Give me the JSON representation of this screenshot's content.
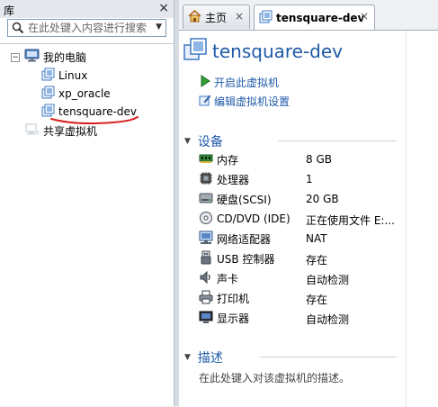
{
  "library": {
    "title": "库",
    "close": "×",
    "search_placeholder": "在此处键入内容进行搜索",
    "tree": {
      "root_label": "我的电脑",
      "vms": [
        {
          "label": "Linux"
        },
        {
          "label": "xp_oracle"
        },
        {
          "label": "tensquare-dev"
        }
      ],
      "shared_label": "共享虚拟机"
    }
  },
  "tabs": [
    {
      "label": "主页",
      "icon": "home-icon"
    },
    {
      "label": "tensquare-dev",
      "icon": "vm-icon",
      "active": true
    }
  ],
  "vm": {
    "title": "tensquare-dev",
    "actions": [
      {
        "label": "开启此虚拟机",
        "icon": "play-icon"
      },
      {
        "label": "编辑虚拟机设置",
        "icon": "edit-settings-icon"
      }
    ],
    "devices_title": "设备",
    "devices": [
      {
        "name": "内存",
        "value": "8 GB",
        "icon": "memory-icon"
      },
      {
        "name": "处理器",
        "value": "1",
        "icon": "cpu-icon"
      },
      {
        "name": "硬盘(SCSI)",
        "value": "20 GB",
        "icon": "hard-disk-icon"
      },
      {
        "name": "CD/DVD (IDE)",
        "value": "正在使用文件 E:...",
        "icon": "cd-dvd-icon"
      },
      {
        "name": "网络适配器",
        "value": "NAT",
        "icon": "network-adapter-icon"
      },
      {
        "name": "USB 控制器",
        "value": "存在",
        "icon": "usb-icon"
      },
      {
        "name": "声卡",
        "value": "自动检测",
        "icon": "sound-card-icon"
      },
      {
        "name": "打印机",
        "value": "存在",
        "icon": "printer-icon"
      },
      {
        "name": "显示器",
        "value": "自动检测",
        "icon": "display-icon"
      }
    ],
    "description_title": "描述",
    "description_hint": "在此处键入对该虚拟机的描述。"
  },
  "colors": {
    "accent": "#1f5aa8",
    "annotation": "#d81e1e",
    "panel_header": "#e4e8ee"
  }
}
